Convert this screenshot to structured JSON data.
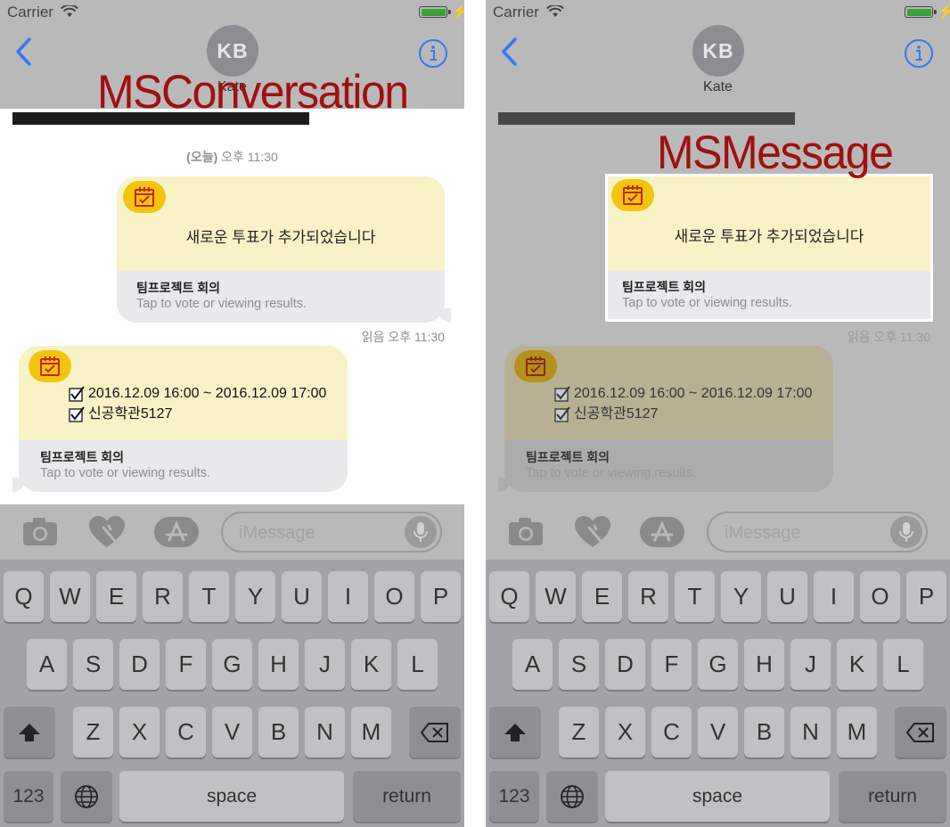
{
  "panels": [
    {
      "status": {
        "carrier": "Carrier"
      },
      "contact": {
        "initials": "KB",
        "name": "Kate"
      },
      "timestamp": {
        "prefix": "(오늘)",
        "time": "오후 11:30"
      },
      "bubble_out": {
        "text": "새로운 투표가 추가되었습니다",
        "caption": "팀프로젝트 회의",
        "subcaption": "Tap to vote or viewing results."
      },
      "read_receipt": "읽음 오후 11:30",
      "bubble_in": {
        "choices": [
          "2016.12.09 16:00 ~ 2016.12.09 17:00",
          "신공학관5127"
        ],
        "caption": "팀프로젝트 회의",
        "subcaption": "Tap to vote or viewing results."
      },
      "input_placeholder": "iMessage",
      "label": "MSConversation"
    },
    {
      "status": {
        "carrier": "Carrier"
      },
      "contact": {
        "initials": "KB",
        "name": "Kate"
      },
      "bubble_out": {
        "text": "새로운 투표가 추가되었습니다",
        "caption": "팀프로젝트 회의",
        "subcaption": "Tap to vote or viewing results."
      },
      "read_receipt": "읽음 오후 11:30",
      "bubble_in": {
        "choices": [
          "2016.12.09 16:00 ~ 2016.12.09 17:00",
          "신공학관5127"
        ],
        "caption": "팀프로젝트 회의",
        "subcaption": "Tap to vote or viewing results."
      },
      "input_placeholder": "iMessage",
      "label": "MSMessage"
    }
  ],
  "keyboard": {
    "row1": [
      "Q",
      "W",
      "E",
      "R",
      "T",
      "Y",
      "U",
      "I",
      "O",
      "P"
    ],
    "row2": [
      "A",
      "S",
      "D",
      "F",
      "G",
      "H",
      "J",
      "K",
      "L"
    ],
    "row3": [
      "Z",
      "X",
      "C",
      "V",
      "B",
      "N",
      "M"
    ],
    "numbers": "123",
    "space": "space",
    "return": "return"
  },
  "icons": [
    "back-chevron-icon",
    "info-icon",
    "wifi-icon",
    "battery-icon",
    "camera-icon",
    "digital-touch-icon",
    "app-store-icon",
    "microphone-icon",
    "calendar-check-icon",
    "checkbox-icon",
    "shift-icon",
    "delete-icon",
    "globe-icon"
  ],
  "colors": {
    "accent": "#3478f6",
    "label": "#a01010",
    "bubble_top": "#f8f2c6",
    "bubble_bottom": "#e9e9eb",
    "app_icon": "#f4c40f"
  }
}
